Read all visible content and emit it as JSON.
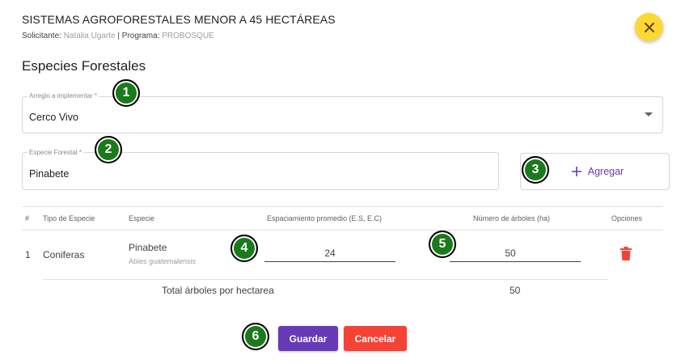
{
  "header": {
    "title": "SISTEMAS AGROFORESTALES MENOR A 45 HECTÁREAS",
    "solicitante_label": "Solicitante:",
    "solicitante_value": "Natalia Ugarte",
    "separator": "|",
    "programa_label": "Programa:",
    "programa_value": "PROBOSQUE"
  },
  "close_icon": "close-icon",
  "section_title": "Especies Forestales",
  "arreglo": {
    "label": "Arreglo a implementar *",
    "value": "Cerco Vivo"
  },
  "especie": {
    "label": "Especie Forestal *",
    "value": "Pinabete"
  },
  "add_button": {
    "label": "Agregar",
    "icon": "plus-icon"
  },
  "badges": [
    "1",
    "2",
    "3",
    "4",
    "5",
    "6"
  ],
  "table": {
    "headers": [
      "#",
      "Tipo de Especie",
      "Especie",
      "Espaciamiento promedio (E.S, E.C)",
      "Número de árboles (ha)",
      "Opciones"
    ],
    "rows": [
      {
        "num": "1",
        "tipo": "Coniferas",
        "especie": "Pinabete",
        "cientifico": "Abies guatemalensis",
        "espaciamiento": "24",
        "arboles": "50"
      }
    ],
    "total_label": "Total árboles por hectarea",
    "total_value": "50"
  },
  "colors": {
    "accent": "#673ab7",
    "danger": "#f44336",
    "close_bg": "#fdd835",
    "badge": "#1b7a1b"
  },
  "actions": {
    "save": "Guardar",
    "cancel": "Cancelar"
  }
}
